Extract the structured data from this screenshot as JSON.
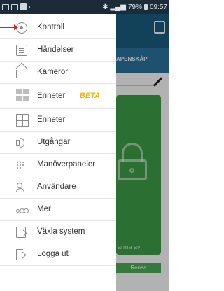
{
  "status_bar": {
    "right_text": "79%",
    "time": "09:57"
  },
  "background_app": {
    "tab_label": "APENSKÅP",
    "arm_label": "arma av",
    "clear_button": "Rensa"
  },
  "drawer": {
    "items": [
      {
        "label": "Kontroll",
        "icon": "eye-icon"
      },
      {
        "label": "Händelser",
        "icon": "list-icon"
      },
      {
        "label": "Kameror",
        "icon": "house-icon"
      },
      {
        "label": "Enheter",
        "icon": "grid-icon",
        "badge": "BETA"
      },
      {
        "label": "Enheter",
        "icon": "grid-outline-icon"
      },
      {
        "label": "Utgångar",
        "icon": "speaker-icon"
      },
      {
        "label": "Manöverpaneler",
        "icon": "keypad-icon"
      },
      {
        "label": "Användare",
        "icon": "users-icon"
      },
      {
        "label": "Mer",
        "icon": "more-icon"
      },
      {
        "label": "Växla system",
        "icon": "switch-system-icon"
      },
      {
        "label": "Logga ut",
        "icon": "logout-icon"
      }
    ]
  },
  "colors": {
    "app_bar": "#1a5d82",
    "tab_bar": "#2b75a0",
    "green_panel": "#3fa04a",
    "beta": "#f5b400",
    "annotation": "#e0201a"
  }
}
